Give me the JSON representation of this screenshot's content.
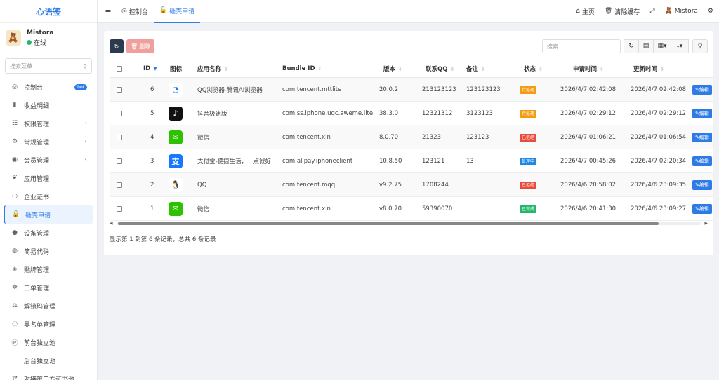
{
  "brand": "心语签",
  "user": {
    "name": "Mistora",
    "status": "在线"
  },
  "menu_search_placeholder": "搜索菜单",
  "menu": [
    {
      "label": "控制台",
      "icon": "dashboard-icon",
      "glyph": "◎",
      "badge": "hot"
    },
    {
      "label": "收益明细",
      "icon": "chart-icon",
      "glyph": "▮"
    },
    {
      "label": "权限管理",
      "icon": "users-icon",
      "glyph": "☷",
      "caret": "‹"
    },
    {
      "label": "常规管理",
      "icon": "gears-icon",
      "glyph": "⚙",
      "caret": "‹"
    },
    {
      "label": "会员管理",
      "icon": "user-icon",
      "glyph": "◉",
      "caret": "‹"
    },
    {
      "label": "应用管理",
      "icon": "leaf-icon",
      "glyph": "❦"
    },
    {
      "label": "企业证书",
      "icon": "circle-icon",
      "glyph": "○"
    },
    {
      "label": "砸壳申请",
      "icon": "lock-icon",
      "glyph": "🔓",
      "active": true
    },
    {
      "label": "设备管理",
      "icon": "dot-icon",
      "glyph": "●"
    },
    {
      "label": "简易代码",
      "icon": "code-icon",
      "glyph": "◍"
    },
    {
      "label": "贴牌管理",
      "icon": "tag-icon",
      "glyph": "◈"
    },
    {
      "label": "工单管理",
      "icon": "ticket-icon",
      "glyph": "☸"
    },
    {
      "label": "解锁码管理",
      "icon": "balance-icon",
      "glyph": "⚖"
    },
    {
      "label": "黑名单管理",
      "icon": "bicycle-icon",
      "glyph": "◌"
    },
    {
      "label": "前台独立池",
      "icon": "p-icon",
      "glyph": "Ⓟ"
    },
    {
      "label": "后台独立池",
      "icon": "apple-icon",
      "glyph": ""
    },
    {
      "label": "对接第三方证书池",
      "icon": "link-icon",
      "glyph": "⇄"
    }
  ],
  "tabs": [
    {
      "label": "控制台",
      "icon": "dashboard-icon",
      "glyph": "◎"
    },
    {
      "label": "砸壳申请",
      "icon": "lock-icon",
      "glyph": "🔓",
      "active": true
    }
  ],
  "topright": {
    "home": "主页",
    "clear_cache": "清除缓存",
    "user": "Mistora"
  },
  "toolbar": {
    "delete": "删除",
    "search_placeholder": "搜索"
  },
  "table": {
    "headers": [
      "ID",
      "图标",
      "应用名称",
      "Bundle ID",
      "版本",
      "联系QQ",
      "备注",
      "状态",
      "申请时间",
      "更新时间"
    ],
    "rows": [
      {
        "id": "6",
        "icon": "qq-browser-icon",
        "icon_bg": "#ffffff",
        "icon_fg": "#1677ff",
        "glyph": "◔",
        "name": "QQ浏览器-腾讯AI浏览器",
        "bundle": "com.tencent.mttlite",
        "version": "20.0.2",
        "qq": "213123123",
        "note": "123123123",
        "status": "待处理",
        "status_color": "#f39c12",
        "apply_time": "2026/4/7 02:42:08",
        "update_time": "2026/4/7 02:42:08"
      },
      {
        "id": "5",
        "icon": "douyin-icon",
        "icon_bg": "#111111",
        "icon_fg": "#ffffff",
        "glyph": "♪",
        "name": "抖音极速版",
        "bundle": "com.ss.iphone.ugc.aweme.lite",
        "version": "38.3.0",
        "qq": "12321312",
        "note": "3123123",
        "status": "待处理",
        "status_color": "#f39c12",
        "apply_time": "2026/4/7 02:29:12",
        "update_time": "2026/4/7 02:29:12"
      },
      {
        "id": "4",
        "icon": "wechat-icon",
        "icon_bg": "#2dc100",
        "icon_fg": "#ffffff",
        "glyph": "✉",
        "name": "微信",
        "bundle": "com.tencent.xin",
        "version": "8.0.70",
        "qq": "21323",
        "note": "123123",
        "status": "已拒绝",
        "status_color": "#e74c3c",
        "apply_time": "2026/4/7 01:06:21",
        "update_time": "2026/4/7 01:06:54"
      },
      {
        "id": "3",
        "icon": "alipay-icon",
        "icon_bg": "#1677ff",
        "icon_fg": "#ffffff",
        "glyph": "支",
        "name": "支付宝-便捷生活，一点就好",
        "bundle": "com.alipay.iphoneclient",
        "version": "10.8.50",
        "qq": "123121",
        "note": "13",
        "status": "处理中",
        "status_color": "#1e88e5",
        "apply_time": "2026/4/7 00:45:26",
        "update_time": "2026/4/7 02:20:34"
      },
      {
        "id": "2",
        "icon": "qq-icon",
        "icon_bg": "#ffffff",
        "icon_fg": "#111111",
        "glyph": "🐧",
        "name": "QQ",
        "bundle": "com.tencent.mqq",
        "version": "v9.2.75",
        "qq": "1708244",
        "note": "",
        "status": "已拒绝",
        "status_color": "#e74c3c",
        "apply_time": "2026/4/6 20:58:02",
        "update_time": "2026/4/6 23:09:35"
      },
      {
        "id": "1",
        "icon": "wechat-icon",
        "icon_bg": "#2dc100",
        "icon_fg": "#ffffff",
        "glyph": "✉",
        "name": "微信",
        "bundle": "com.tencent.xin",
        "version": "v8.0.70",
        "qq": "59390070",
        "note": "",
        "status": "已完成",
        "status_color": "#22b76a",
        "apply_time": "2026/4/6 20:41:30",
        "update_time": "2026/4/6 23:09:27"
      }
    ],
    "edit_label": "编辑"
  },
  "footer": "显示第 1 到第 6 条记录，总共 6 条记录"
}
